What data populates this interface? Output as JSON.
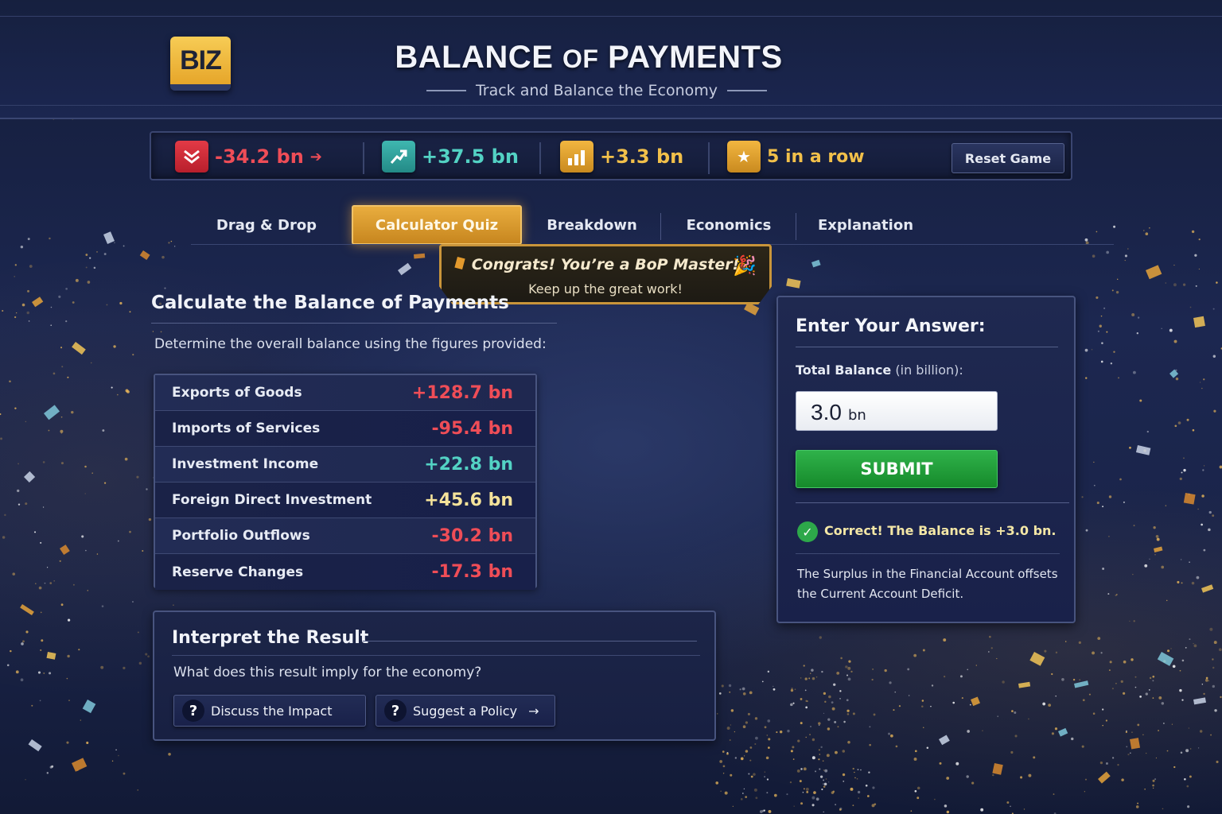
{
  "header": {
    "logo": "BIZ",
    "title_part1": "BALANCE",
    "title_part2": "OF",
    "title_part3": "PAYMENTS",
    "subtitle": "Track and Balance the Economy"
  },
  "stats": {
    "current_account": "-34.2 bn",
    "financial_account": "+37.5 bn",
    "overall": "+3.3 bn",
    "streak": "5 in a row",
    "reset_label": "Reset Game"
  },
  "tabs": [
    {
      "label": "Drag & Drop",
      "active": false
    },
    {
      "label": "Calculator Quiz",
      "active": true
    },
    {
      "label": "Breakdown",
      "active": false
    },
    {
      "label": "Economics",
      "active": false
    },
    {
      "label": "Explanation",
      "active": false
    }
  ],
  "congrats": {
    "title": "Congrats! You’re a BoP Master!",
    "subtitle": "Keep up the great work!"
  },
  "calc": {
    "title": "Calculate the Balance of Payments",
    "description": "Determine the overall balance using the figures provided:",
    "rows": [
      {
        "label": "Exports of Goods",
        "value": "+128.7 bn",
        "color": "#ef4d57"
      },
      {
        "label": "Imports of Services",
        "value": "-95.4 bn",
        "color": "#ef4d57"
      },
      {
        "label": "Investment Income",
        "value": "+22.8 bn",
        "color": "#53d2c4"
      },
      {
        "label": "Foreign Direct Investment",
        "value": "+45.6 bn",
        "color": "#f5e39a"
      },
      {
        "label": "Portfolio Outflows",
        "value": "-30.2 bn",
        "color": "#ef4d57"
      },
      {
        "label": "Reserve Changes",
        "value": "-17.3 bn",
        "color": "#ef4d57"
      }
    ]
  },
  "interpret": {
    "title": "Interpret the Result",
    "question": "What does this result imply for the economy?",
    "discuss_label": "Discuss the Impact",
    "policy_label": "Suggest a Policy"
  },
  "answer": {
    "title": "Enter Your Answer:",
    "field_label": "Total Balance",
    "field_unit": "(in billion):",
    "value": "3.0",
    "value_unit": "bn",
    "submit_label": "SUBMIT",
    "result": "Correct! The Balance is +3.0 bn.",
    "explanation": "The Surplus in the Financial Account offsets the Current Account Deficit."
  },
  "colors": {
    "negative": "#ef4d57",
    "positive_teal": "#53d2c4",
    "gold": "#f2c04a",
    "accent_tab": "#e0a23a",
    "success": "#2fb24a"
  }
}
